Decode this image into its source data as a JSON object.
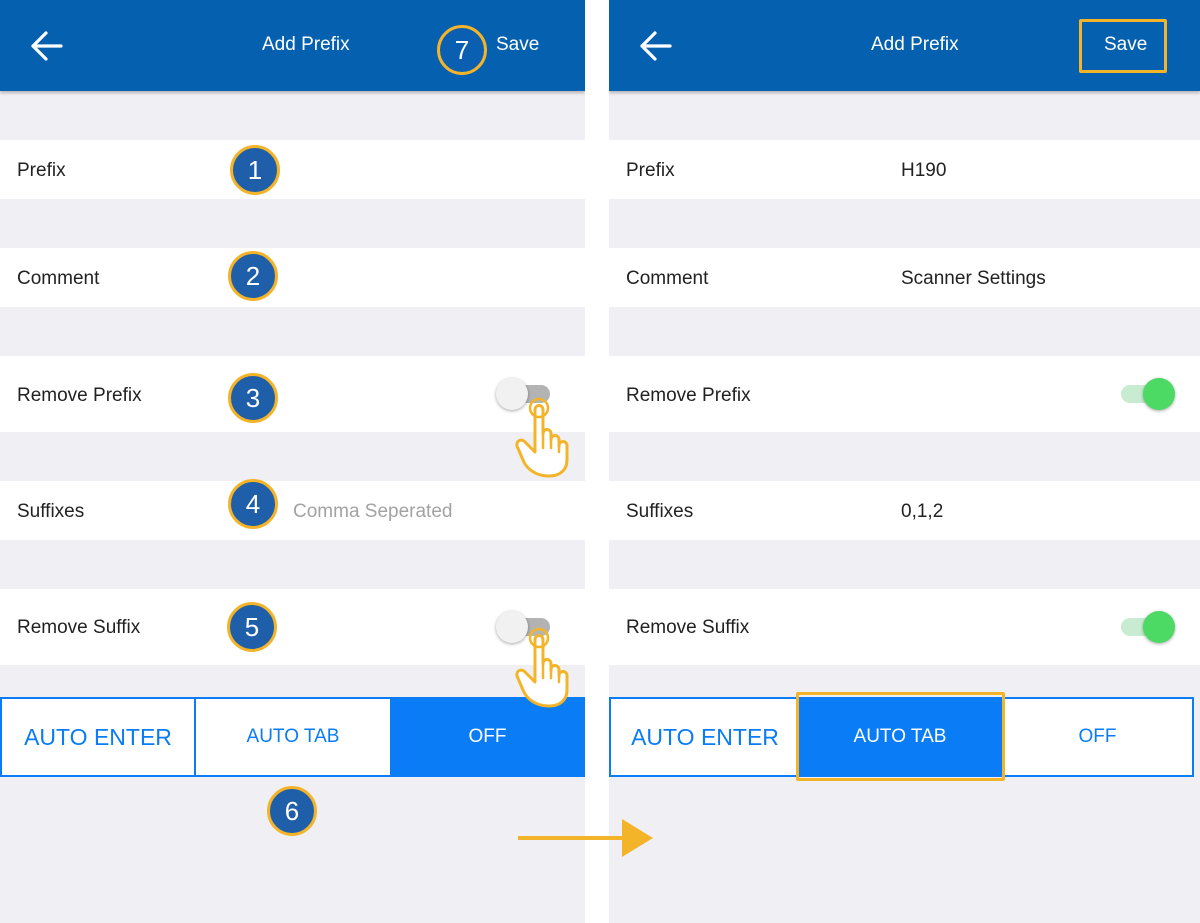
{
  "left_screen": {
    "header": {
      "title": "Add Prefix",
      "save_label": "Save"
    },
    "rows": {
      "prefix": {
        "label": "Prefix",
        "value": ""
      },
      "comment": {
        "label": "Comment",
        "value": ""
      },
      "remove_prefix": {
        "label": "Remove Prefix",
        "enabled": false
      },
      "suffixes": {
        "label": "Suffixes",
        "placeholder": "Comma Seperated",
        "value": ""
      },
      "remove_suffix": {
        "label": "Remove Suffix",
        "enabled": false
      }
    },
    "enter_mode": {
      "options": [
        "AUTO ENTER",
        "AUTO TAB",
        "OFF"
      ],
      "selected": "OFF"
    }
  },
  "right_screen": {
    "header": {
      "title": "Add Prefix",
      "save_label": "Save"
    },
    "rows": {
      "prefix": {
        "label": "Prefix",
        "value": "H190"
      },
      "comment": {
        "label": "Comment",
        "value": "Scanner Settings"
      },
      "remove_prefix": {
        "label": "Remove Prefix",
        "enabled": true
      },
      "suffixes": {
        "label": "Suffixes",
        "value": "0,1,2"
      },
      "remove_suffix": {
        "label": "Remove Suffix",
        "enabled": true
      }
    },
    "enter_mode": {
      "options": [
        "AUTO ENTER",
        "AUTO TAB",
        "OFF"
      ],
      "selected": "AUTO TAB"
    }
  },
  "step_badges": [
    "1",
    "2",
    "3",
    "4",
    "5",
    "6",
    "7"
  ],
  "colors": {
    "app_bar": "#0560b0",
    "background": "#efeff4",
    "segment_blue": "#0a7cf5",
    "toggle_on": "#4cd964",
    "highlight": "#f4b42a",
    "badge_fill": "#1f5ea8"
  },
  "icons": {
    "back": "arrow-left-icon",
    "tap": "hand-pointer-icon",
    "flow": "arrow-right-icon"
  }
}
